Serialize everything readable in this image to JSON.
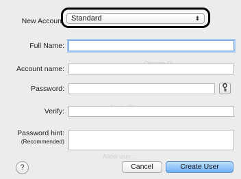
{
  "form": {
    "new_account_label": "New Accoun",
    "account_type": "Standard",
    "full_name_label": "Full Name:",
    "full_name_value": "",
    "account_name_label": "Account name:",
    "account_name_value": "",
    "password_label": "Password:",
    "password_value": "",
    "verify_label": "Verify:",
    "verify_value": "",
    "hint_label": "Password hint:",
    "hint_sublabel": "(Recommended)",
    "hint_value": ""
  },
  "buttons": {
    "help": "?",
    "cancel": "Cancel",
    "create": "Create User",
    "key_icon_glyph": "🔑"
  },
  "icons": {
    "dropdown_arrows": "up-down-chevron-icon",
    "password_assistant": "key-icon",
    "help": "help-icon"
  },
  "colors": {
    "focus_ring": "#a6c8f3",
    "primary_button": "#6fb0f5",
    "sheet_background": "#ececec"
  }
}
